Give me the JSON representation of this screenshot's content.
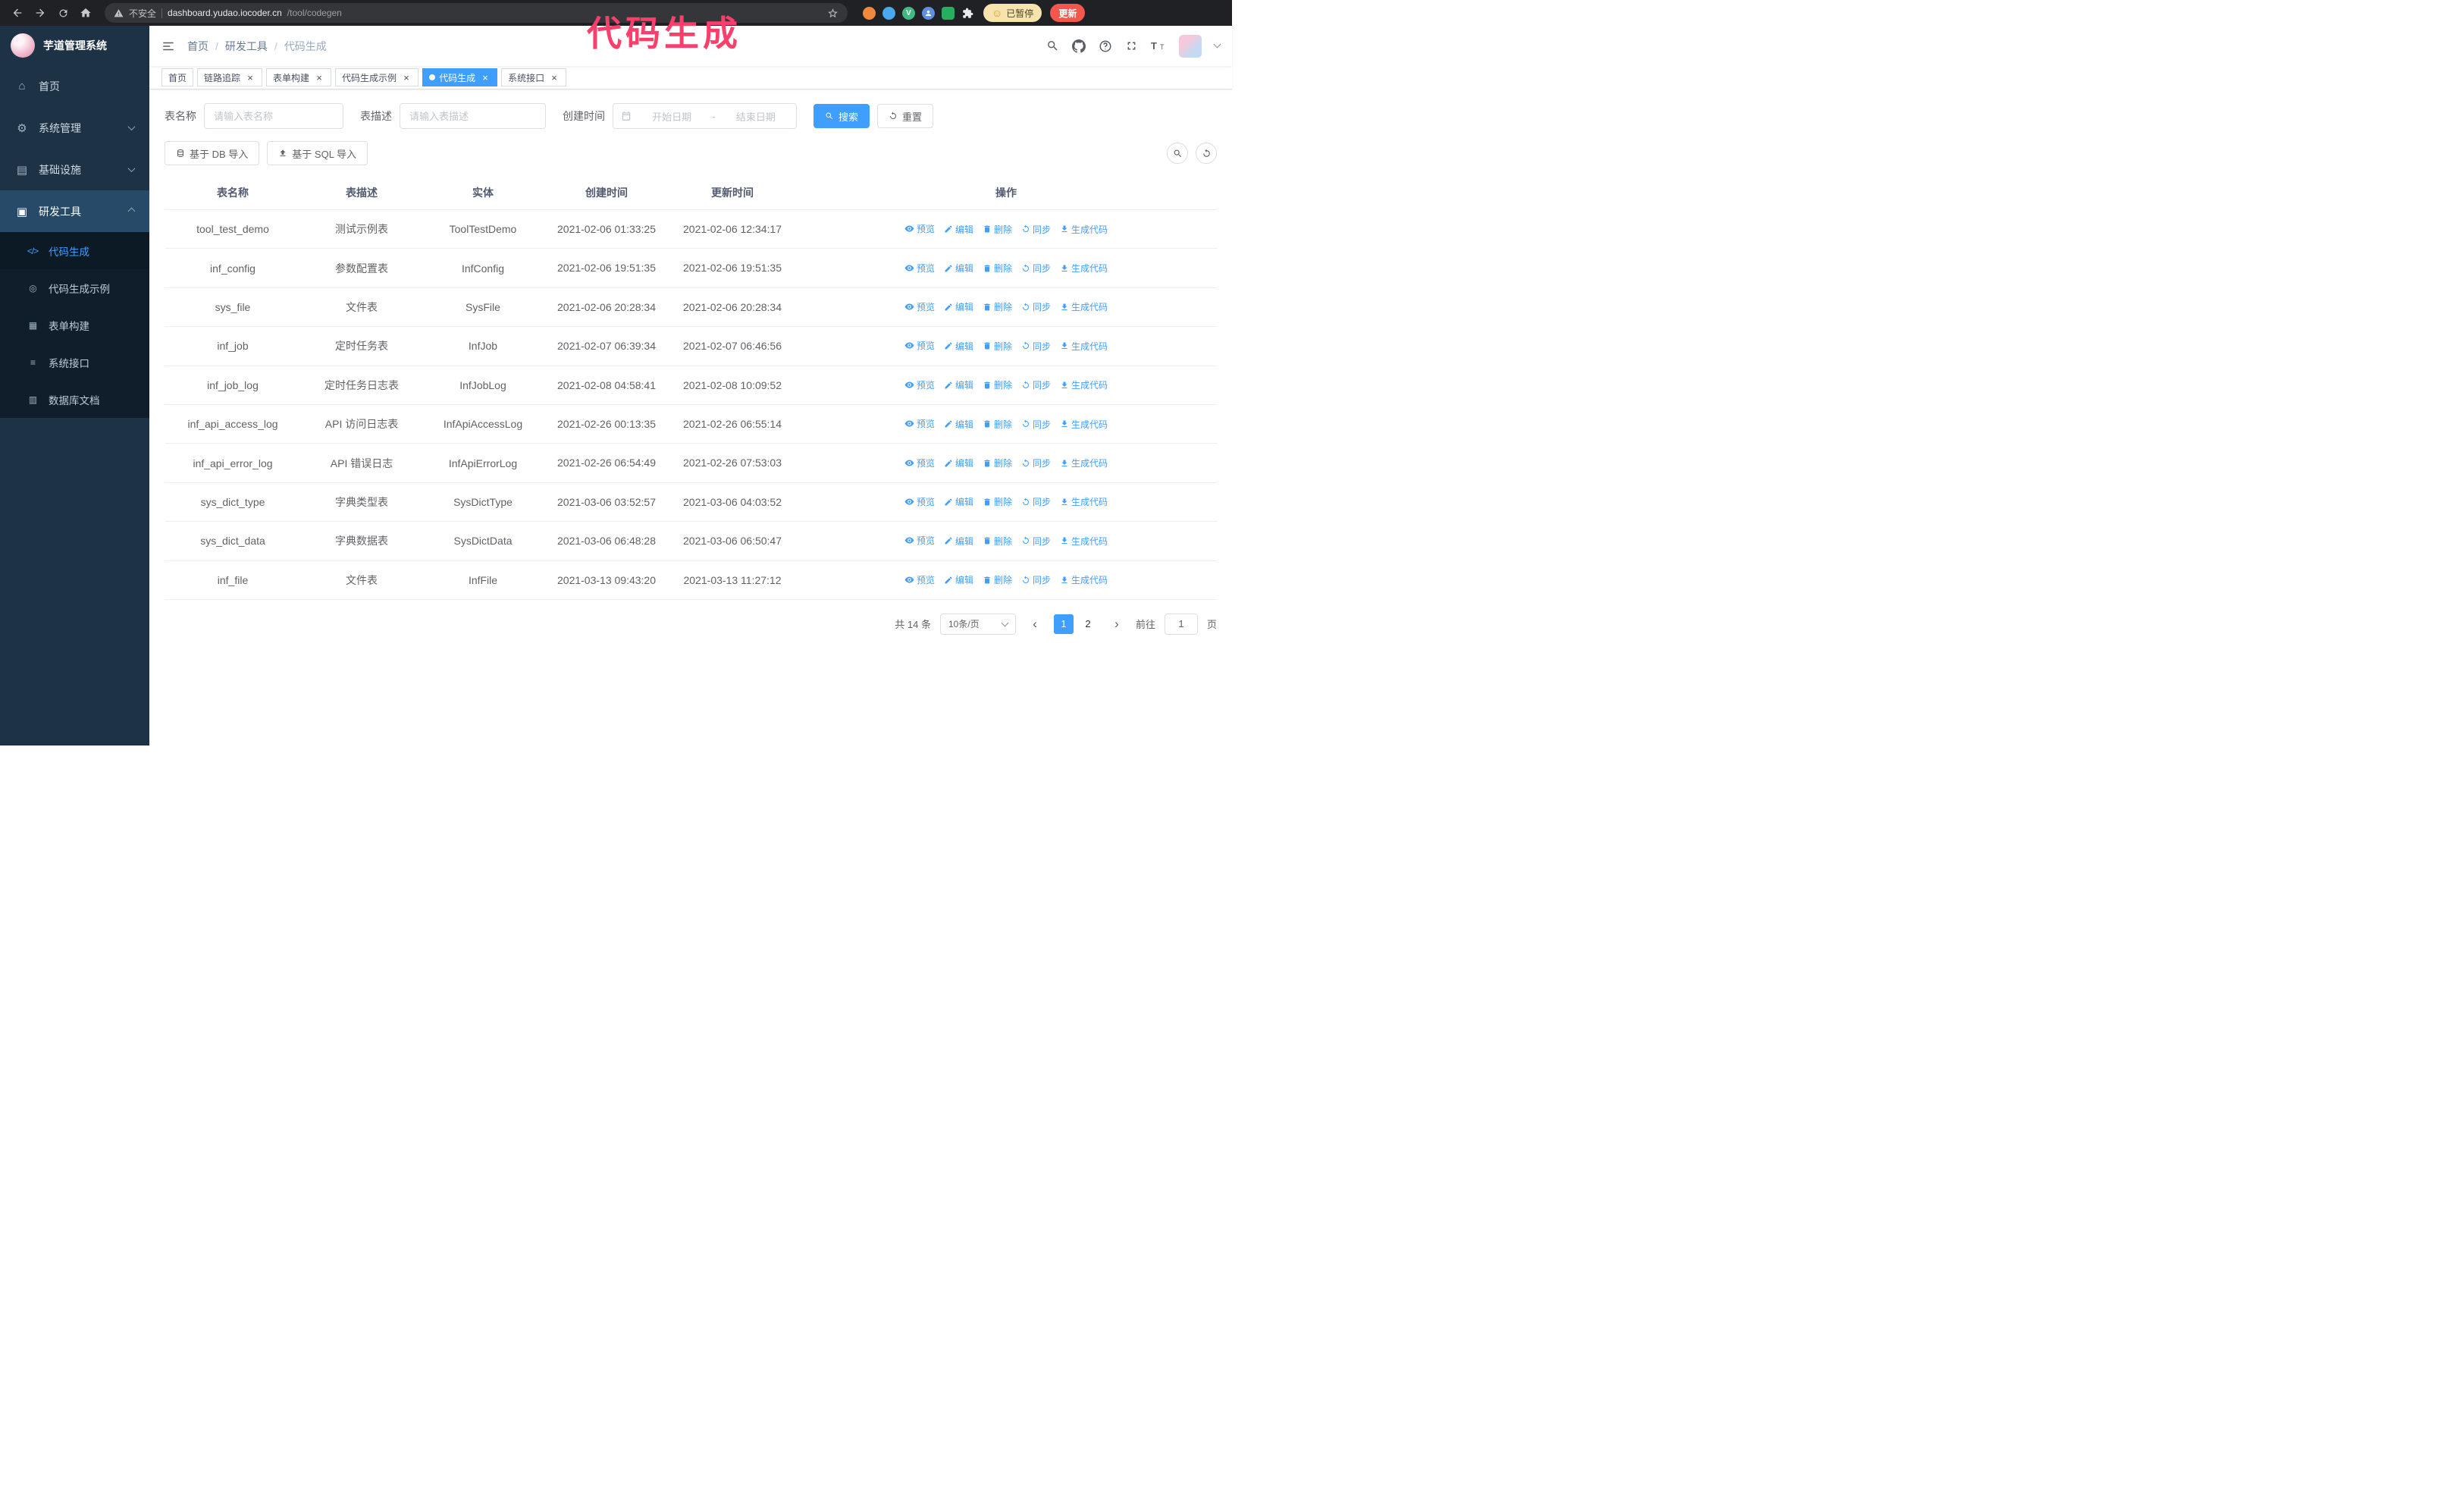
{
  "annotation": {
    "text": "代码生成"
  },
  "browser": {
    "security_label": "不安全",
    "url_host": "dashboard.yudao.iocoder.cn",
    "url_path": "/tool/codegen",
    "paused_badge": "已暂停",
    "update_button": "更新"
  },
  "sidebar": {
    "logo_title": "芋道管理系统",
    "menu": [
      {
        "id": "home",
        "label": "首页",
        "icon": "home-icon",
        "chevron": "",
        "active": false
      },
      {
        "id": "system-mgmt",
        "label": "系统管理",
        "icon": "gear-icon",
        "chevron": "down",
        "active": false
      },
      {
        "id": "infrastructure",
        "label": "基础设施",
        "icon": "infra-icon",
        "chevron": "down",
        "active": false
      },
      {
        "id": "dev-tools",
        "label": "研发工具",
        "icon": "tools-icon",
        "chevron": "up",
        "active": true
      }
    ],
    "submenu": [
      {
        "id": "codegen",
        "label": "代码生成",
        "icon": "code-icon",
        "active": true
      },
      {
        "id": "codegen-demo",
        "label": "代码生成示例",
        "icon": "example-icon",
        "active": false
      },
      {
        "id": "form-builder",
        "label": "表单构建",
        "icon": "form-icon",
        "active": false
      },
      {
        "id": "system-api",
        "label": "系统接口",
        "icon": "api-icon",
        "active": false
      },
      {
        "id": "db-doc",
        "label": "数据库文档",
        "icon": "db-doc-icon",
        "active": false
      }
    ]
  },
  "header": {
    "breadcrumb": [
      "首页",
      "研发工具",
      "代码生成"
    ]
  },
  "tabs": [
    {
      "label": "首页",
      "closable": false,
      "active": false
    },
    {
      "label": "链路追踪",
      "closable": true,
      "active": false
    },
    {
      "label": "表单构建",
      "closable": true,
      "active": false
    },
    {
      "label": "代码生成示例",
      "closable": true,
      "active": false
    },
    {
      "label": "代码生成",
      "closable": true,
      "active": true
    },
    {
      "label": "系统接口",
      "closable": true,
      "active": false
    }
  ],
  "filters": {
    "table_name_label": "表名称",
    "table_name_placeholder": "请输入表名称",
    "table_desc_label": "表描述",
    "table_desc_placeholder": "请输入表描述",
    "create_time_label": "创建时间",
    "start_placeholder": "开始日期",
    "separator": "-",
    "end_placeholder": "结束日期",
    "search_label": "搜索",
    "reset_label": "重置"
  },
  "toolbar": {
    "import_db_label": "基于 DB 导入",
    "import_sql_label": "基于 SQL 导入"
  },
  "table": {
    "columns": [
      "表名称",
      "表描述",
      "实体",
      "创建时间",
      "更新时间",
      "操作"
    ],
    "action_labels": [
      "预览",
      "编辑",
      "删除",
      "同步",
      "生成代码"
    ],
    "rows": [
      {
        "name": "tool_test_demo",
        "desc": "测试示例表",
        "entity": "ToolTestDemo",
        "created": "2021-02-06 01:33:25",
        "updated": "2021-02-06 12:34:17"
      },
      {
        "name": "inf_config",
        "desc": "参数配置表",
        "entity": "InfConfig",
        "created": "2021-02-06 19:51:35",
        "updated": "2021-02-06 19:51:35"
      },
      {
        "name": "sys_file",
        "desc": "文件表",
        "entity": "SysFile",
        "created": "2021-02-06 20:28:34",
        "updated": "2021-02-06 20:28:34"
      },
      {
        "name": "inf_job",
        "desc": "定时任务表",
        "entity": "InfJob",
        "created": "2021-02-07 06:39:34",
        "updated": "2021-02-07 06:46:56"
      },
      {
        "name": "inf_job_log",
        "desc": "定时任务日志表",
        "entity": "InfJobLog",
        "created": "2021-02-08 04:58:41",
        "updated": "2021-02-08 10:09:52"
      },
      {
        "name": "inf_api_access_log",
        "desc": "API 访问日志表",
        "entity": "InfApiAccessLog",
        "created": "2021-02-26 00:13:35",
        "updated": "2021-02-26 06:55:14"
      },
      {
        "name": "inf_api_error_log",
        "desc": "API 错误日志",
        "entity": "InfApiErrorLog",
        "created": "2021-02-26 06:54:49",
        "updated": "2021-02-26 07:53:03"
      },
      {
        "name": "sys_dict_type",
        "desc": "字典类型表",
        "entity": "SysDictType",
        "created": "2021-03-06 03:52:57",
        "updated": "2021-03-06 04:03:52"
      },
      {
        "name": "sys_dict_data",
        "desc": "字典数据表",
        "entity": "SysDictData",
        "created": "2021-03-06 06:48:28",
        "updated": "2021-03-06 06:50:47"
      },
      {
        "name": "inf_file",
        "desc": "文件表",
        "entity": "InfFile",
        "created": "2021-03-13 09:43:20",
        "updated": "2021-03-13 11:27:12"
      }
    ]
  },
  "pagination": {
    "total_label": "共 14 条",
    "page_size_label": "10条/页",
    "pages": [
      "1",
      "2"
    ],
    "active_page": "1",
    "goto_label": "前往",
    "goto_value": "1",
    "goto_suffix": "页"
  },
  "colors": {
    "accent": "#409eff",
    "annotation": "#fb3f6c",
    "sidebar_bg": "#1d3245",
    "submenu_bg": "#101e2b"
  }
}
